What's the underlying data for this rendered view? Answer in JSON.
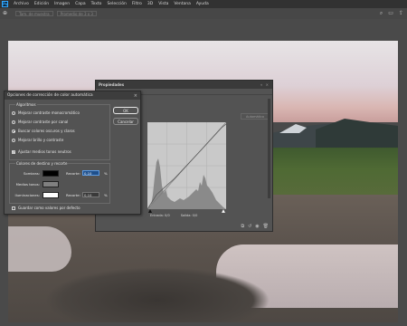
{
  "menu": {
    "logo": "Ps",
    "items": [
      "Archivo",
      "Edición",
      "Imagen",
      "Capa",
      "Texto",
      "Selección",
      "Filtro",
      "3D",
      "Vista",
      "Ventana",
      "Ayuda"
    ]
  },
  "options_bar": {
    "tool_glyph": "⊕",
    "field1": "Tam. de muestra",
    "field2": "Promedio de 3 x 3"
  },
  "properties_panel": {
    "title": "Propiedades",
    "header_controls": "« ×",
    "preset": "Automático",
    "input_label": "Entrada: 0/0",
    "output_label": "Salida: 0/0"
  },
  "auto_color_dialog": {
    "title": "Opciones de corrección de color automática",
    "algorithms_title": "Algoritmos",
    "options": [
      {
        "label": "Mejorar contraste monocromático",
        "selected": false
      },
      {
        "label": "Mejorar contraste por canal",
        "selected": false
      },
      {
        "label": "Buscar colores oscuros y claros",
        "selected": true
      },
      {
        "label": "Mejorar brillo y contraste",
        "selected": false
      }
    ],
    "snap_neutral": {
      "label": "Ajustar medios tonos neutros",
      "checked": true
    },
    "ok_label": "OK",
    "cancel_label": "Cancelar",
    "targets_title": "Colores de destino y recorte",
    "targets": [
      {
        "label": "Sombras:",
        "swatch": "#000000",
        "clip_label": "Recorte:",
        "clip_value": "0,10",
        "unit": "%",
        "active": true
      },
      {
        "label": "Medios tonos:",
        "swatch": "#808080",
        "clip_label": "",
        "clip_value": "",
        "unit": "",
        "active": false
      },
      {
        "label": "Iluminaciones:",
        "swatch": "#ffffff",
        "clip_label": "Recorte:",
        "clip_value": "0,10",
        "unit": "%",
        "active": false
      }
    ],
    "save_default": {
      "label": "Guardar como valores por defecto",
      "checked": false
    }
  },
  "colors": {
    "accent": "#31a8ff",
    "ui_dark": "#323232",
    "ui_panel": "#535353",
    "field_active": "#1f4f8a"
  }
}
